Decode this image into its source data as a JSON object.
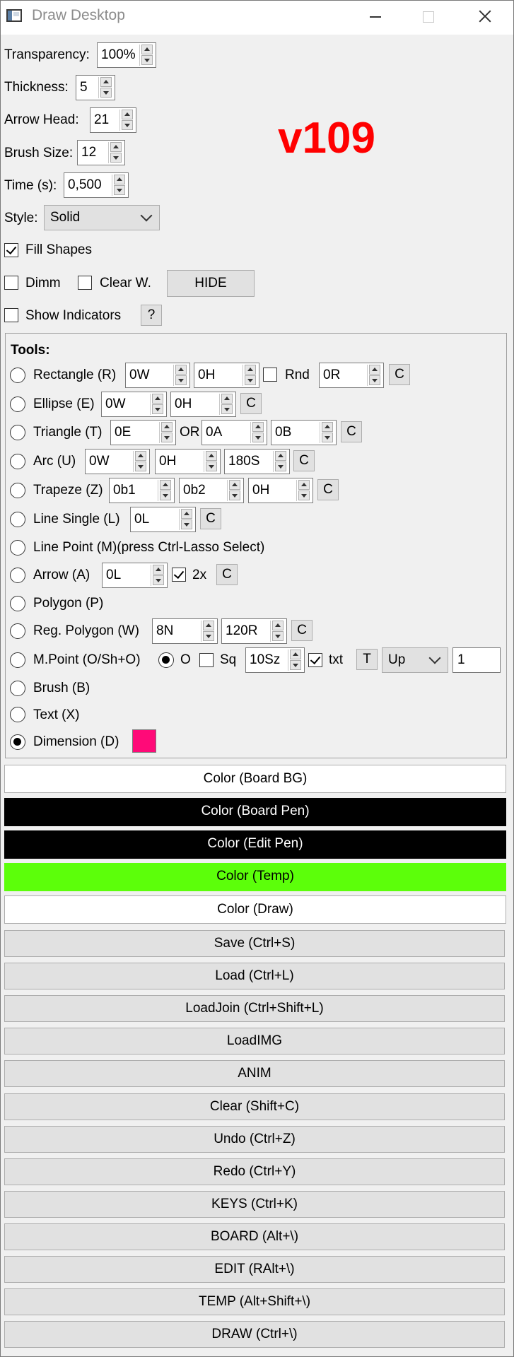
{
  "window": {
    "title": "Draw Desktop"
  },
  "version": "v109",
  "settings": {
    "transparency": {
      "label": "Transparency:",
      "value": "100%"
    },
    "thickness": {
      "label": "Thickness:",
      "value": "5"
    },
    "arrow_head": {
      "label": "Arrow Head:",
      "value": "21"
    },
    "brush_size": {
      "label": "Brush Size:",
      "value": "12"
    },
    "time": {
      "label": "Time (s):",
      "value": "0,500"
    },
    "style": {
      "label": "Style:",
      "value": "Solid"
    },
    "fill_shapes": {
      "label": "Fill Shapes",
      "checked": true
    },
    "dimm": {
      "label": "Dimm",
      "checked": false
    },
    "clear_w": {
      "label": "Clear W.",
      "checked": false
    },
    "hide_label": "HIDE",
    "show_indicators": {
      "label": "Show Indicators",
      "checked": false
    },
    "help_label": "?"
  },
  "tools": {
    "heading": "Tools:",
    "rectangle": {
      "label": "Rectangle (R)",
      "w": "0W",
      "h": "0H",
      "rnd_label": "Rnd",
      "r": "0R",
      "c": "C"
    },
    "ellipse": {
      "label": "Ellipse (E)",
      "w": "0W",
      "h": "0H",
      "c": "C"
    },
    "triangle": {
      "label": "Triangle (T)",
      "e": "0E",
      "or_label": "OR",
      "a": "0A",
      "b": "0B",
      "c": "C"
    },
    "arc": {
      "label": "Arc (U)",
      "w": "0W",
      "h": "0H",
      "s": "180S",
      "c": "C"
    },
    "trapeze": {
      "label": "Trapeze (Z)",
      "b1": "0b1",
      "b2": "0b2",
      "h": "0H",
      "c": "C"
    },
    "line_single": {
      "label": "Line Single (L)",
      "l": "0L",
      "c": "C"
    },
    "line_point": {
      "label": "Line Point (M)(press Ctrl-Lasso Select)"
    },
    "arrow": {
      "label": "Arrow (A)",
      "l": "0L",
      "x2_label": "2x",
      "c": "C"
    },
    "polygon": {
      "label": "Polygon (P)"
    },
    "reg_polygon": {
      "label": "Reg. Polygon (W)",
      "n": "8N",
      "r": "120R",
      "c": "C"
    },
    "mpoint": {
      "label": "M.Point (O/Sh+O)",
      "o_label": "O",
      "sq_label": "Sq",
      "sz": "10Sz",
      "txt_label": "txt",
      "t": "T",
      "dir": "Up",
      "num": "1"
    },
    "brush": {
      "label": "Brush (B)"
    },
    "text": {
      "label": "Text (X)"
    },
    "dimension": {
      "label": "Dimension (D)",
      "swatch": "#ff0a78",
      "selected": true
    }
  },
  "colors": {
    "board_bg": {
      "label": "Color (Board BG)",
      "bg": "#ffffff",
      "fg": "#000000"
    },
    "board_pen": {
      "label": "Color (Board Pen)",
      "bg": "#000000",
      "fg": "#ffffff"
    },
    "edit_pen": {
      "label": "Color (Edit Pen)",
      "bg": "#000000",
      "fg": "#ffffff"
    },
    "temp": {
      "label": "Color (Temp)",
      "bg": "#5cff0a",
      "fg": "#000000"
    },
    "draw": {
      "label": "Color (Draw)",
      "bg": "#ffffff",
      "fg": "#000000"
    }
  },
  "commands": [
    "Save (Ctrl+S)",
    "Load (Ctrl+L)",
    "LoadJoin (Ctrl+Shift+L)",
    "LoadIMG",
    "ANIM",
    "Clear (Shift+C)",
    "Undo (Ctrl+Z)",
    "Redo (Ctrl+Y)",
    "KEYS (Ctrl+K)",
    "BOARD (Alt+\\)",
    "EDIT (RAlt+\\)",
    "TEMP (Alt+Shift+\\)",
    "DRAW (Ctrl+\\)"
  ]
}
